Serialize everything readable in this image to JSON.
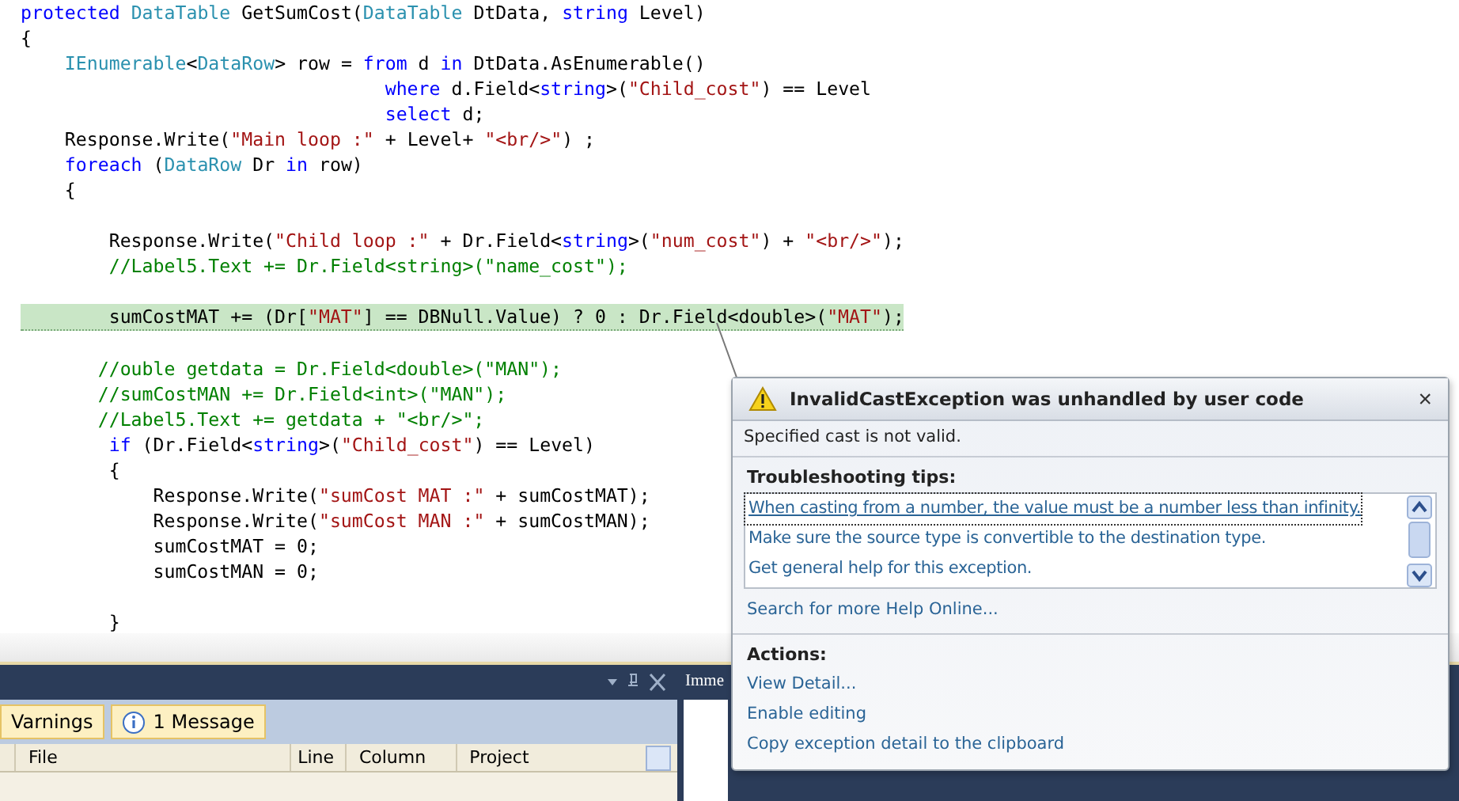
{
  "code_lines": [
    {
      "segments": [
        {
          "text": "protected ",
          "kind": "kw"
        },
        {
          "text": "DataTable",
          "kind": "type"
        },
        {
          "text": " GetSumCost(",
          "kind": "plain"
        },
        {
          "text": "DataTable",
          "kind": "type"
        },
        {
          "text": " DtData, ",
          "kind": "plain"
        },
        {
          "text": "string",
          "kind": "kw"
        },
        {
          "text": " Level)",
          "kind": "plain"
        }
      ]
    },
    {
      "segments": [
        {
          "text": "{",
          "kind": "plain"
        }
      ]
    },
    {
      "segments": [
        {
          "text": "    IEnumerable",
          "kind": "type"
        },
        {
          "text": "<",
          "kind": "plain"
        },
        {
          "text": "DataRow",
          "kind": "type"
        },
        {
          "text": "> row = ",
          "kind": "plain"
        },
        {
          "text": "from",
          "kind": "kw"
        },
        {
          "text": " d ",
          "kind": "plain"
        },
        {
          "text": "in",
          "kind": "kw"
        },
        {
          "text": " DtData.AsEnumerable()",
          "kind": "plain"
        }
      ]
    },
    {
      "segments": [
        {
          "text": "                                 where",
          "kind": "kw"
        },
        {
          "text": " d.Field<",
          "kind": "plain"
        },
        {
          "text": "string",
          "kind": "kw"
        },
        {
          "text": ">(",
          "kind": "plain"
        },
        {
          "text": "\"Child_cost\"",
          "kind": "str"
        },
        {
          "text": ") == Level",
          "kind": "plain"
        }
      ]
    },
    {
      "segments": [
        {
          "text": "                                 select",
          "kind": "kw"
        },
        {
          "text": " d;",
          "kind": "plain"
        }
      ]
    },
    {
      "segments": [
        {
          "text": "    Response.Write(",
          "kind": "plain"
        },
        {
          "text": "\"Main loop :\"",
          "kind": "str"
        },
        {
          "text": " + Level+ ",
          "kind": "plain"
        },
        {
          "text": "\"<br/>\"",
          "kind": "str"
        },
        {
          "text": ") ;",
          "kind": "plain"
        }
      ]
    },
    {
      "segments": [
        {
          "text": "    foreach",
          "kind": "kw"
        },
        {
          "text": " (",
          "kind": "plain"
        },
        {
          "text": "DataRow",
          "kind": "type"
        },
        {
          "text": " Dr ",
          "kind": "plain"
        },
        {
          "text": "in",
          "kind": "kw"
        },
        {
          "text": " row)",
          "kind": "plain"
        }
      ]
    },
    {
      "segments": [
        {
          "text": "    {",
          "kind": "plain"
        }
      ]
    },
    {
      "gap_before": true,
      "segments": [
        {
          "text": "        Response.Write(",
          "kind": "plain"
        },
        {
          "text": "\"Child loop :\"",
          "kind": "str"
        },
        {
          "text": " + Dr.Field<",
          "kind": "plain"
        },
        {
          "text": "string",
          "kind": "kw"
        },
        {
          "text": ">(",
          "kind": "plain"
        },
        {
          "text": "\"num_cost\"",
          "kind": "str"
        },
        {
          "text": ") + ",
          "kind": "plain"
        },
        {
          "text": "\"<br/>\"",
          "kind": "str"
        },
        {
          "text": ");",
          "kind": "plain"
        }
      ]
    },
    {
      "segments": [
        {
          "text": "        //Label5.Text += Dr.Field<string>(\"name_cost\");",
          "kind": "cmt"
        }
      ]
    },
    {
      "gap_before": true,
      "highlighted": true,
      "segments": [
        {
          "text": "        sumCostMAT += (Dr[",
          "kind": "plain"
        },
        {
          "text": "\"MAT\"",
          "kind": "str"
        },
        {
          "text": "] == DBNull.Value) ? 0 : Dr.Field<double>(",
          "kind": "plain"
        },
        {
          "text": "\"MAT\"",
          "kind": "str"
        },
        {
          "text": ");",
          "kind": "plain"
        }
      ]
    },
    {
      "gap_before": true,
      "segments": [
        {
          "text": "       //ouble getdata = Dr.Field<double>(\"MAN\");",
          "kind": "cmt"
        }
      ]
    },
    {
      "segments": [
        {
          "text": "       //sumCostMAN += Dr.Field<int>(\"MAN\");",
          "kind": "cmt"
        }
      ]
    },
    {
      "segments": [
        {
          "text": "       //Label5.Text += getdata + \"<br/>\";",
          "kind": "cmt"
        }
      ]
    },
    {
      "segments": [
        {
          "text": "        if",
          "kind": "kw"
        },
        {
          "text": " (Dr.Field<",
          "kind": "plain"
        },
        {
          "text": "string",
          "kind": "kw"
        },
        {
          "text": ">(",
          "kind": "plain"
        },
        {
          "text": "\"Child_cost\"",
          "kind": "str"
        },
        {
          "text": ") == Level)",
          "kind": "plain"
        }
      ]
    },
    {
      "segments": [
        {
          "text": "        {",
          "kind": "plain"
        }
      ]
    },
    {
      "segments": [
        {
          "text": "            Response.Write(",
          "kind": "plain"
        },
        {
          "text": "\"sumCost MAT :\"",
          "kind": "str"
        },
        {
          "text": " + sumCostMAT);",
          "kind": "plain"
        }
      ]
    },
    {
      "segments": [
        {
          "text": "            Response.Write(",
          "kind": "plain"
        },
        {
          "text": "\"sumCost MAN :\"",
          "kind": "str"
        },
        {
          "text": " + sumCostMAN);",
          "kind": "plain"
        }
      ]
    },
    {
      "segments": [
        {
          "text": "            sumCostMAT = 0;",
          "kind": "plain"
        }
      ]
    },
    {
      "segments": [
        {
          "text": "            sumCostMAN = 0;",
          "kind": "plain"
        }
      ]
    },
    {
      "gap_before": true,
      "segments": [
        {
          "text": "        }",
          "kind": "plain"
        }
      ]
    }
  ],
  "exception_popup": {
    "title": "InvalidCastException was unhandled by user code",
    "close": "×",
    "message": "Specified cast is not valid.",
    "tips_heading": "Troubleshooting tips:",
    "tips": [
      {
        "text": "When casting from a number, the value must be a number less than infinity.",
        "focused": true
      },
      {
        "text": "Make sure the source type is convertible to the destination type.",
        "focused": false
      },
      {
        "text": "Get general help for this exception.",
        "focused": false
      }
    ],
    "search_link": "Search for more Help Online...",
    "actions_heading": "Actions:",
    "actions": [
      "View Detail...",
      "Enable editing",
      "Copy exception detail to the clipboard"
    ]
  },
  "error_list": {
    "tabs": [
      {
        "label": "Varnings",
        "kind": "warning"
      },
      {
        "label": "1 Message",
        "kind": "message"
      }
    ],
    "columns": [
      "File",
      "Line",
      "Column",
      "Project"
    ]
  },
  "immediate_panel": {
    "title": "Imme"
  }
}
